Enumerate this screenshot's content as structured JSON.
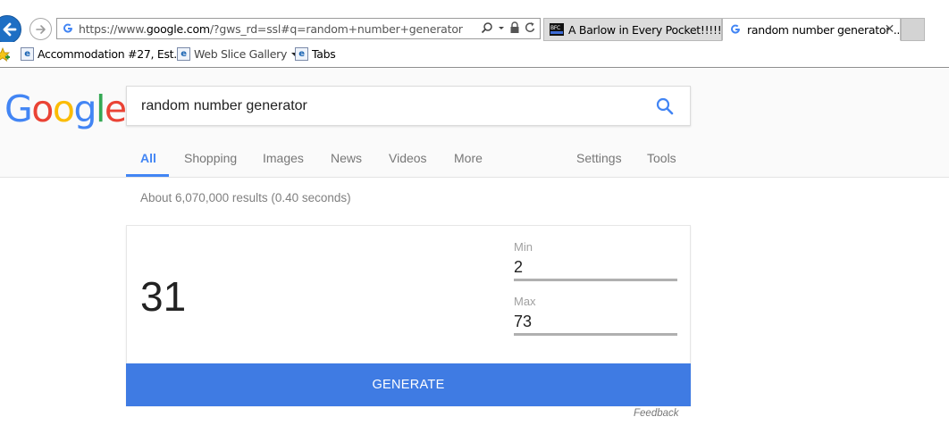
{
  "browser": {
    "address_url_prefix": "https://www.",
    "address_url_domain": "google.com",
    "address_url_path": "/?gws_rd=ssl#q=random+number+generator",
    "tabs": [
      {
        "label": "A Barlow in Every Pocket!!!!!",
        "icon": "bfc-favicon",
        "active": false
      },
      {
        "label": "random number generator ...",
        "icon": "google-favicon",
        "active": true
      }
    ],
    "tab_close_glyph": "✕",
    "favorites": [
      {
        "label": "Accommodation #27, Est...",
        "icon": "ie-page-icon"
      },
      {
        "label": "Web Slice Gallery",
        "icon": "ie-page-icon",
        "dropdown": true
      },
      {
        "label": "Tabs",
        "icon": "ie-page-icon"
      }
    ]
  },
  "google": {
    "logo_letters": [
      "G",
      "o",
      "o",
      "g",
      "l",
      "e"
    ],
    "search_query": "random number generator",
    "nav": {
      "all": "All",
      "shopping": "Shopping",
      "images": "Images",
      "news": "News",
      "videos": "Videos",
      "more": "More",
      "settings": "Settings",
      "tools": "Tools"
    },
    "result_stats": "About 6,070,000 results (0.40 seconds)",
    "rng": {
      "result": "31",
      "min_label": "Min",
      "min_value": "2",
      "max_label": "Max",
      "max_value": "73",
      "generate_label": "GENERATE"
    },
    "feedback": "Feedback",
    "colors": {
      "accent_blue": "#4285f4",
      "generate_button": "#3f7be3",
      "back_button": "#1e6fc4"
    }
  }
}
